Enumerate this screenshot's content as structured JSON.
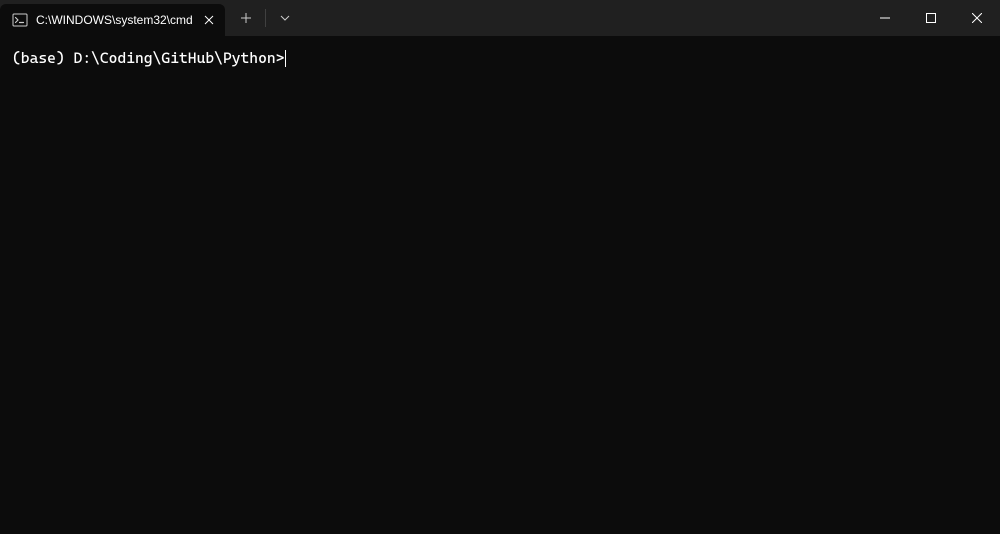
{
  "titlebar": {
    "tab": {
      "title": "C:\\WINDOWS\\system32\\cmd"
    }
  },
  "terminal": {
    "prompt": "(base) D:\\Coding\\GitHub\\Python>"
  }
}
